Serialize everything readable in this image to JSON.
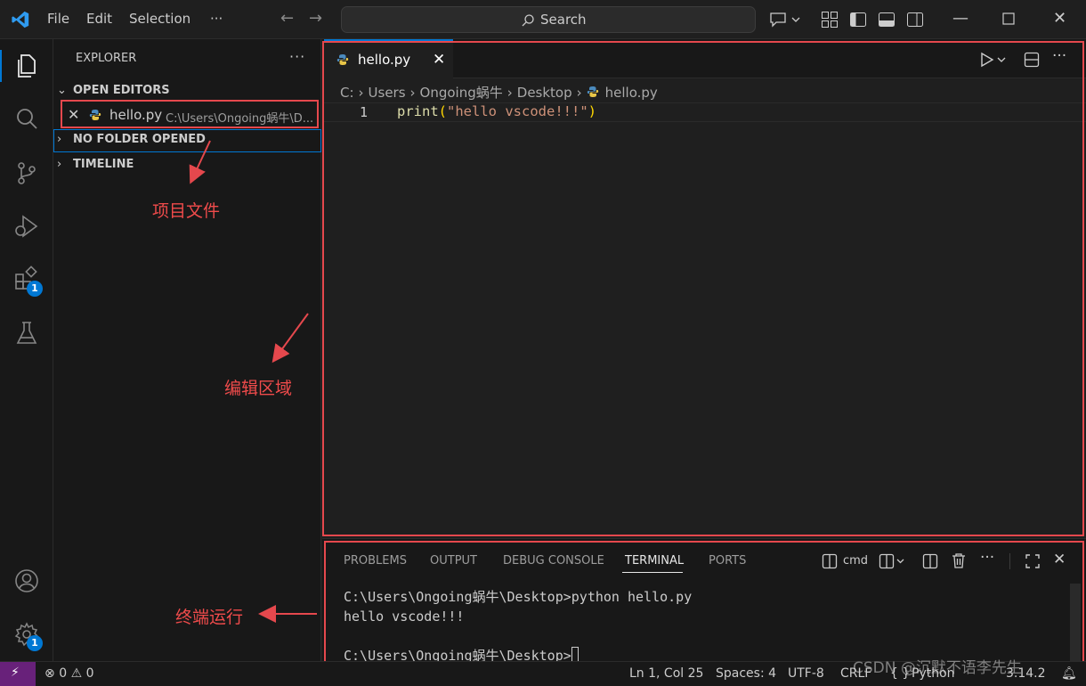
{
  "menu": {
    "file": "File",
    "edit": "Edit",
    "selection": "Selection",
    "more": "···"
  },
  "search": {
    "label": "Search"
  },
  "explorer": {
    "title": "EXPLORER",
    "dots": "···",
    "open_editors": "OPEN EDITORS",
    "open_file_name": "hello.py",
    "open_file_path": "C:\\Users\\Ongoing蜗牛\\D...",
    "no_folder": "NO FOLDER OPENED",
    "timeline": "TIMELINE"
  },
  "activity": {
    "extensions_badge": "1",
    "settings_badge": "1"
  },
  "editor": {
    "tab_label": "hello.py",
    "breadcrumb": [
      "C:",
      "Users",
      "Ongoing蜗牛",
      "Desktop",
      "hello.py"
    ],
    "line_number": "1",
    "code_fn": "print",
    "code_open": "(",
    "code_str": "\"hello vscode!!!\"",
    "code_close": ")"
  },
  "panel": {
    "tabs": [
      "PROBLEMS",
      "OUTPUT",
      "DEBUG CONSOLE",
      "TERMINAL",
      "PORTS"
    ],
    "active_tab": "TERMINAL",
    "shell": "cmd",
    "terminal_lines": [
      "C:\\Users\\Ongoing蜗牛\\Desktop>python hello.py",
      "hello vscode!!!",
      "",
      "C:\\Users\\Ongoing蜗牛\\Desktop>"
    ]
  },
  "annotations": {
    "project_files": "项目文件",
    "edit_area": "编辑区域",
    "terminal_run": "终端运行"
  },
  "status": {
    "errors": "0",
    "warnings": "0",
    "position": "Ln 1, Col 25",
    "spaces": "Spaces: 4",
    "encoding": "UTF-8",
    "eol": "CRLF",
    "language": "Python",
    "version": "3.14.2"
  },
  "watermark": "CSDN @沉默不语李先生",
  "colors": {
    "accent": "#0078d4",
    "annotation_red": "#e5484d",
    "remote_purple": "#68217a"
  }
}
